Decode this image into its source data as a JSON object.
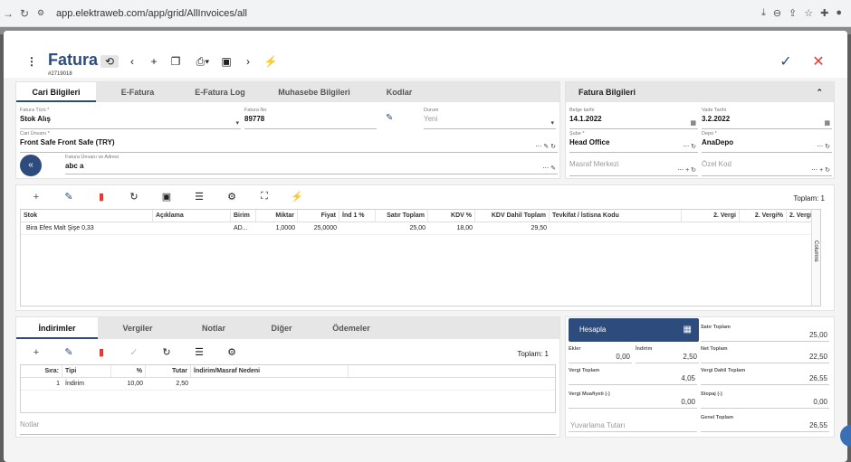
{
  "browser": {
    "url": "app.elektraweb.com/app/grid/AllInvoices/all"
  },
  "header": {
    "title": "Fatura",
    "number": "#2719018"
  },
  "colors": {
    "brand": "#2d4c7d",
    "delete": "#e53935",
    "confirm": "#2d4c7d",
    "close": "#e53935"
  },
  "tabs_top": [
    "Cari Bilgileri",
    "E-Fatura",
    "E-Fatura Log",
    "Muhasebe Bilgileri",
    "Kodlar"
  ],
  "form": {
    "fatura_turu": {
      "label": "Fatura Türü *",
      "value": "Stok Alış"
    },
    "fatura_no": {
      "label": "Fatura No",
      "value": "89778"
    },
    "durum": {
      "label": "Durum",
      "value": "Yeni"
    },
    "cari_unvani": {
      "label": "Cari Ünvanı *",
      "value": "Front Safe Front Safe (TRY)"
    },
    "unvan_adres": {
      "label": "Fatura Ünvanı ve Adresi",
      "value": "abc a"
    }
  },
  "fatura_bilgileri": {
    "title": "Fatura Bilgileri",
    "belge_tarihi": {
      "label": "Belge tarihi",
      "value": "14.1.2022"
    },
    "vade_tarihi": {
      "label": "Vade Tarihi",
      "value": "3.2.2022"
    },
    "sube": {
      "label": "Şube *",
      "value": "Head Office"
    },
    "depo": {
      "label": "Depo *",
      "value": "AnaDepo"
    },
    "masraf_merkezi": {
      "placeholder": "Masraf Merkezi"
    },
    "ozel_kod": {
      "placeholder": "Özel Kod"
    }
  },
  "items": {
    "total_label": "Toplam: 1",
    "columns": [
      "Stok",
      "Açıklama",
      "Birim",
      "Miktar",
      "Fiyat",
      "İnd 1 %",
      "Satır Toplam",
      "KDV %",
      "KDV Dahil Toplam",
      "Tevkifat / İstisna Kodu",
      "2. Vergi",
      "2. Vergi%",
      "2. Vergi"
    ],
    "rows": [
      [
        "Bira Efes Malt Şişe 0,33",
        "",
        "AD...",
        "1,0000",
        "25,0000",
        "",
        "25,00",
        "18,00",
        "29,50",
        "",
        "",
        "",
        ""
      ]
    ],
    "columns_label": "Columns"
  },
  "tabs_bottom": [
    "İndirimler",
    "Vergiler",
    "Notlar",
    "Diğer",
    "Ödemeler"
  ],
  "discounts": {
    "total_label": "Toplam: 1",
    "columns": [
      "Sıra:",
      "Tipi",
      "%",
      "Tutar",
      "İndirim/Masraf Nedeni"
    ],
    "rows": [
      [
        "1",
        "İndirim",
        "10,00",
        "2,50",
        ""
      ]
    ]
  },
  "notes": {
    "placeholder": "Notlar"
  },
  "totals": {
    "hesapla": "Hesapla",
    "satir_toplam": {
      "label": "Satır Toplam",
      "value": "25,00"
    },
    "ekler": {
      "label": "Ekler",
      "value": "0,00"
    },
    "indirim": {
      "label": "İndirim",
      "value": "2,50"
    },
    "net_toplam": {
      "label": "Net Toplam",
      "value": "22,50"
    },
    "vergi_toplam": {
      "label": "Vergi Toplam",
      "value": "4,05"
    },
    "vergi_dahil": {
      "label": "Vergi Dahil Toplam",
      "value": "26,55"
    },
    "vergi_muafiyet": {
      "label": "Vergi Muafiyeti (-)",
      "value": "0,00"
    },
    "stopaj": {
      "label": "Stopaj (-)",
      "value": "0,00"
    },
    "yuvarlama": {
      "placeholder": "Yuvarlama Tutarı"
    },
    "genel_toplam": {
      "label": "Genel Toplam",
      "value": "26,55"
    }
  }
}
